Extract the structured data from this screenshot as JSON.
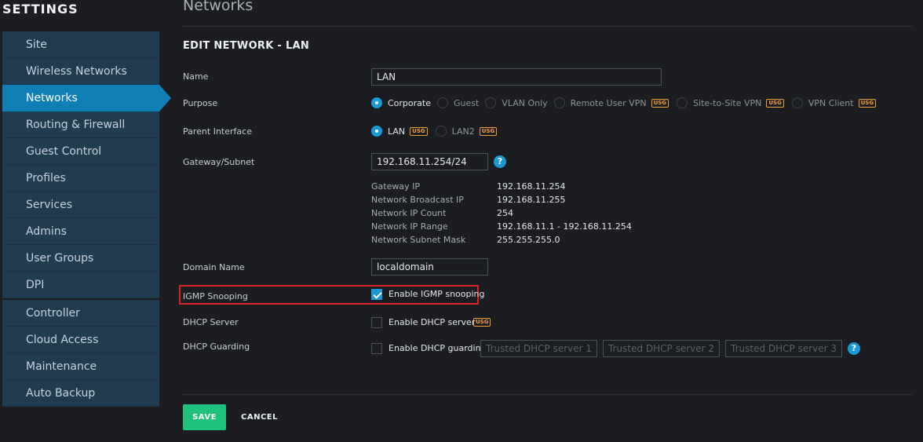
{
  "sidebar": {
    "title": "SETTINGS",
    "group1": [
      {
        "label": "Site"
      },
      {
        "label": "Wireless Networks"
      },
      {
        "label": "Networks",
        "active": true
      },
      {
        "label": "Routing & Firewall"
      },
      {
        "label": "Guest Control"
      },
      {
        "label": "Profiles"
      },
      {
        "label": "Services"
      },
      {
        "label": "Admins"
      },
      {
        "label": "User Groups"
      },
      {
        "label": "DPI"
      }
    ],
    "group2": [
      {
        "label": "Controller"
      },
      {
        "label": "Cloud Access"
      },
      {
        "label": "Maintenance"
      },
      {
        "label": "Auto Backup"
      }
    ]
  },
  "page": {
    "title": "Networks",
    "form_title": "EDIT NETWORK - LAN"
  },
  "form": {
    "name": {
      "label": "Name",
      "value": "LAN"
    },
    "purpose": {
      "label": "Purpose",
      "options": [
        {
          "label": "Corporate",
          "selected": true
        },
        {
          "label": "Guest"
        },
        {
          "label": "VLAN Only"
        },
        {
          "label": "Remote User VPN",
          "badge": "USG"
        },
        {
          "label": "Site-to-Site VPN",
          "badge": "USG"
        },
        {
          "label": "VPN Client",
          "badge": "USG"
        }
      ]
    },
    "parent_interface": {
      "label": "Parent Interface",
      "options": [
        {
          "label": "LAN",
          "badge": "USG",
          "selected": true
        },
        {
          "label": "LAN2",
          "badge": "USG"
        }
      ]
    },
    "gateway": {
      "label": "Gateway/Subnet",
      "value": "192.168.11.254/24",
      "help": "?",
      "details": [
        {
          "key": "Gateway IP",
          "value": "192.168.11.254"
        },
        {
          "key": "Network Broadcast IP",
          "value": "192.168.11.255"
        },
        {
          "key": "Network IP Count",
          "value": "254"
        },
        {
          "key": "Network IP Range",
          "value": "192.168.11.1 - 192.168.11.254"
        },
        {
          "key": "Network Subnet Mask",
          "value": "255.255.255.0"
        }
      ]
    },
    "domain": {
      "label": "Domain Name",
      "value": "localdomain"
    },
    "igmp": {
      "label": "IGMP Snooping",
      "check_label": "Enable IGMP snooping",
      "checked": true
    },
    "dhcp_server": {
      "label": "DHCP Server",
      "check_label": "Enable DHCP server",
      "badge": "USG",
      "checked": false
    },
    "dhcp_guarding": {
      "label": "DHCP Guarding",
      "check_label": "Enable DHCP guarding",
      "checked": false,
      "placeholders": [
        "Trusted DHCP server 1",
        "Trusted DHCP server 2",
        "Trusted DHCP server 3"
      ],
      "help": "?"
    }
  },
  "actions": {
    "save": "SAVE",
    "cancel": "CANCEL"
  },
  "colors": {
    "accent": "#1a99d6",
    "save": "#1ec27d",
    "badge": "#f3a03b",
    "highlight": "#d9212c"
  }
}
